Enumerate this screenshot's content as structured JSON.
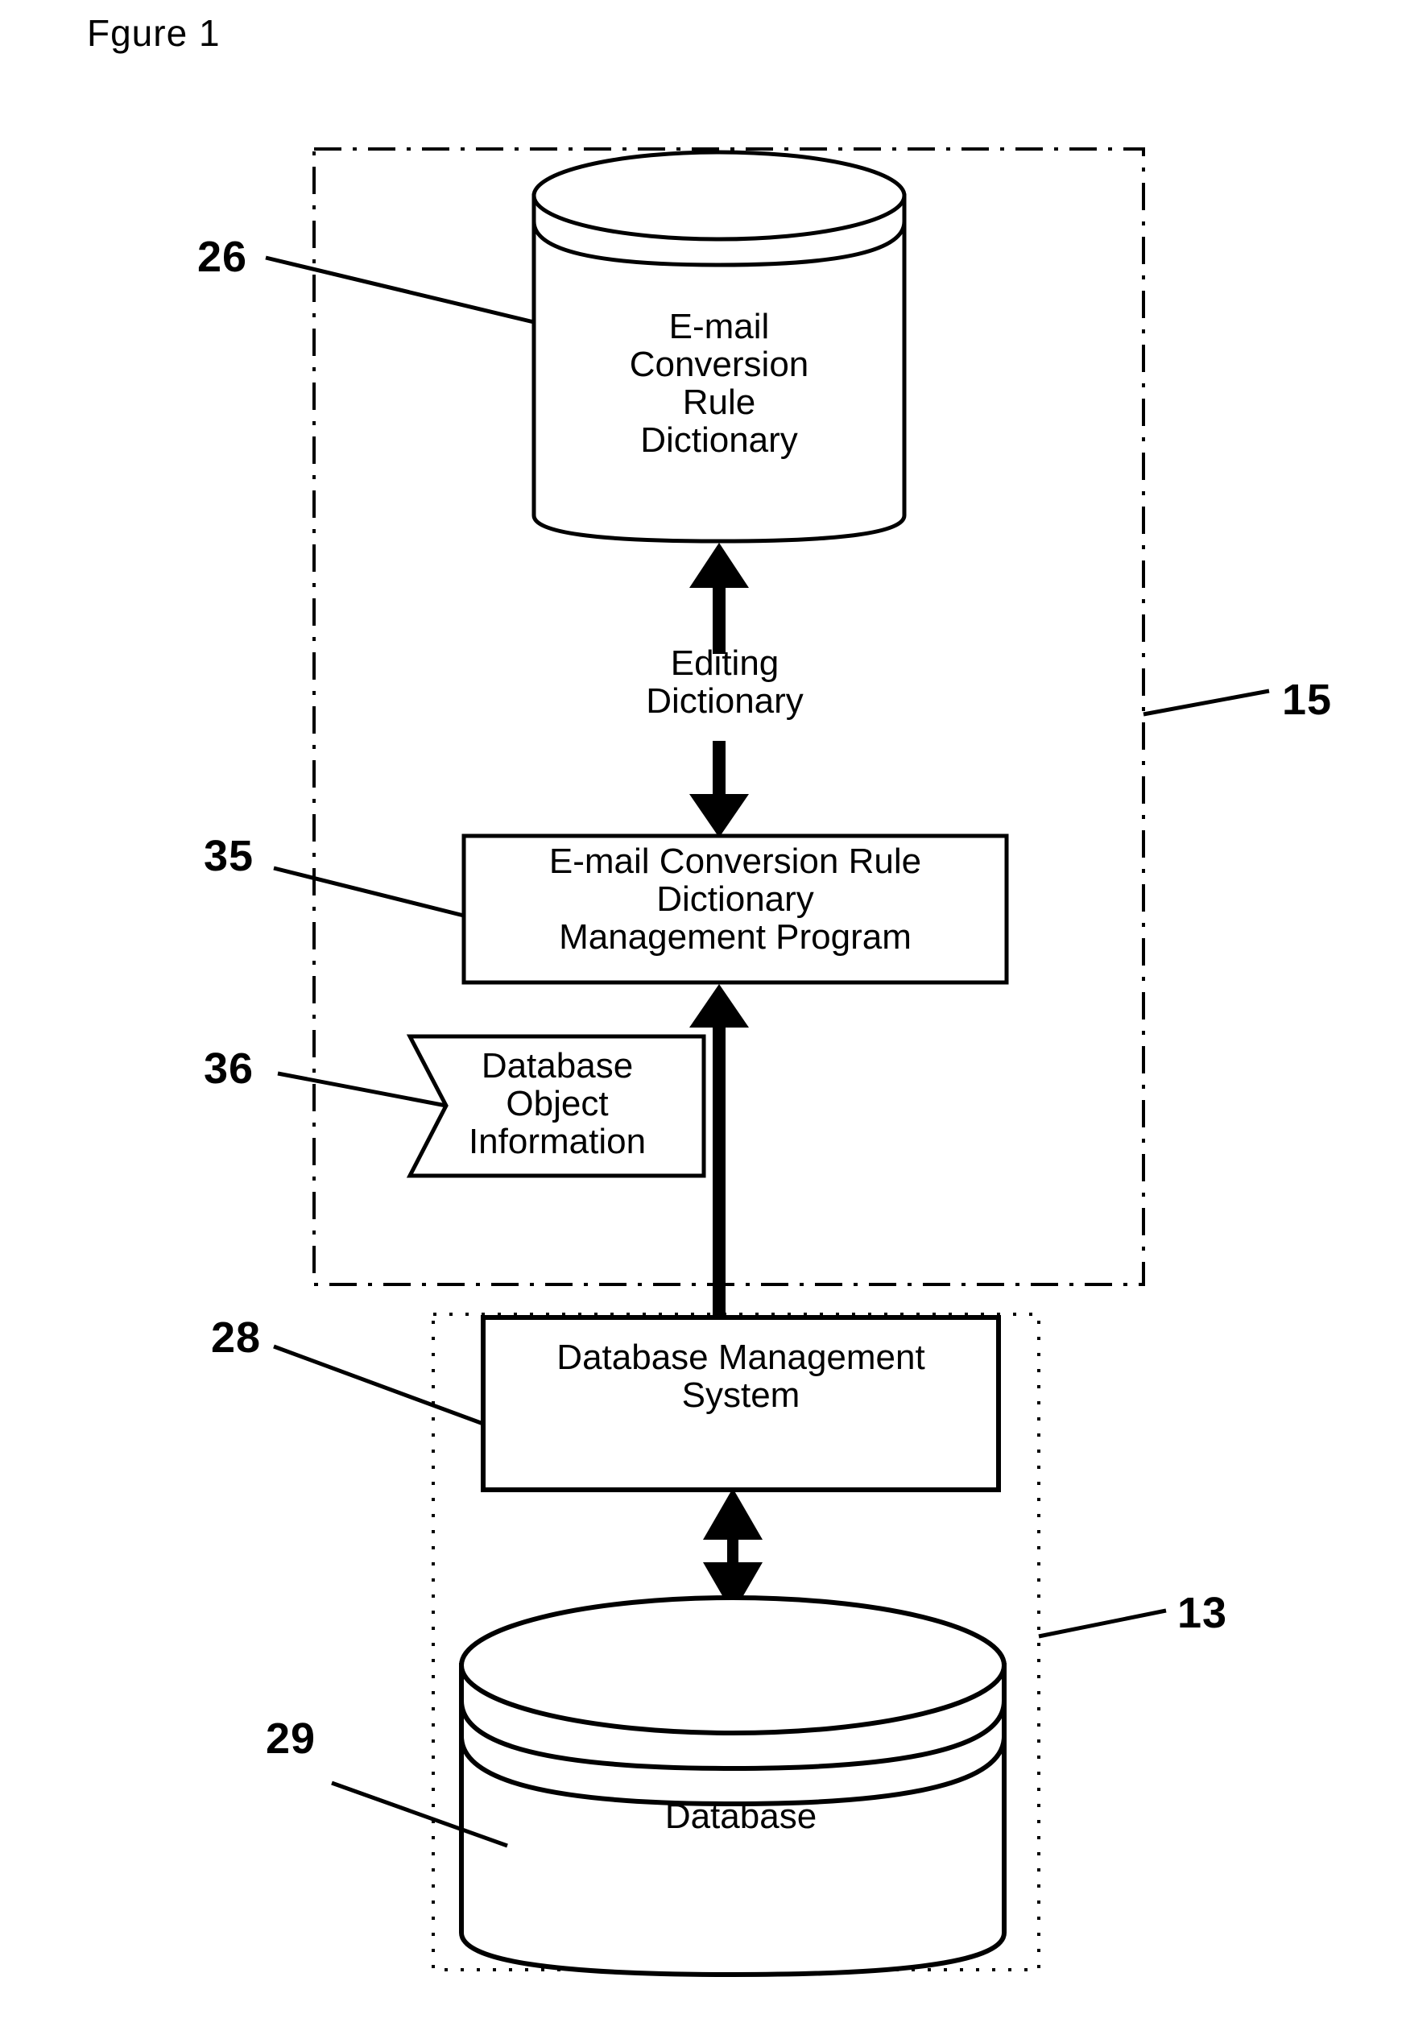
{
  "figure": {
    "title": "Fgure 1"
  },
  "reference_numerals": {
    "dictionary_store": "26",
    "management_program": "35",
    "database_object_information": "36",
    "database_management_system": "28",
    "database": "29",
    "outer_dashdot_group": "15",
    "outer_dotted_group": "13"
  },
  "nodes": {
    "dictionary_cylinder": {
      "lines": [
        "E-mail",
        "Conversion",
        "Rule",
        "Dictionary"
      ]
    },
    "editing_arrow_label": {
      "lines": [
        "Editing",
        "Dictionary"
      ]
    },
    "management_program": {
      "lines": [
        "E-mail Conversion Rule",
        "Dictionary",
        "Management Program"
      ]
    },
    "database_object_information": {
      "lines": [
        "Database",
        "Object",
        "Information"
      ]
    },
    "database_management_system": {
      "lines": [
        "Database Management",
        "System"
      ]
    },
    "database_cylinder": {
      "lines": [
        "Database"
      ]
    }
  },
  "style": {
    "stroke": "#000000",
    "background": "#ffffff"
  }
}
